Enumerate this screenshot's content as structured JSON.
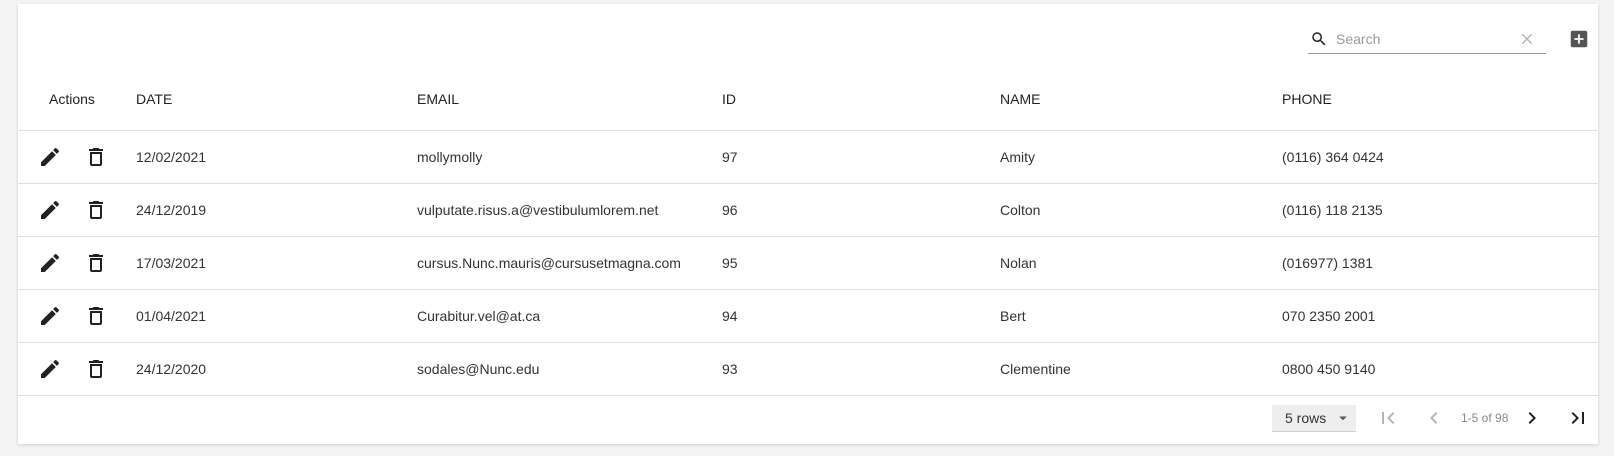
{
  "toolbar": {
    "search_placeholder": "Search",
    "search_value": "",
    "search_icon": "search-icon",
    "clear_icon": "close-icon",
    "add_icon": "add-box-icon"
  },
  "table": {
    "columns": [
      "Actions",
      "DATE",
      "EMAIL",
      "ID",
      "NAME",
      "PHONE"
    ],
    "row_action_icons": [
      "edit-icon",
      "delete-icon"
    ],
    "rows": [
      {
        "date": "12/02/2021",
        "email": "mollymolly",
        "id": "97",
        "name": "Amity",
        "phone": "(0116) 364 0424"
      },
      {
        "date": "24/12/2019",
        "email": "vulputate.risus.a@vestibulumlorem.net",
        "id": "96",
        "name": "Colton",
        "phone": "(0116) 118 2135"
      },
      {
        "date": "17/03/2021",
        "email": "cursus.Nunc.mauris@cursusetmagna.com",
        "id": "95",
        "name": "Nolan",
        "phone": "(016977) 1381"
      },
      {
        "date": "01/04/2021",
        "email": "Curabitur.vel@at.ca",
        "id": "94",
        "name": "Bert",
        "phone": "070 2350 2001"
      },
      {
        "date": "24/12/2020",
        "email": "sodales@Nunc.edu",
        "id": "93",
        "name": "Clementine",
        "phone": "0800 450 9140"
      }
    ]
  },
  "pagination": {
    "rows_per_page_label": "5 rows",
    "range_label": "1-5 of 98"
  },
  "colors": {
    "icon": "#222222",
    "icon_disabled": "#b5b5b5",
    "divider": "#e0e0e0",
    "background": "#f3f3f3",
    "card": "#ffffff"
  }
}
